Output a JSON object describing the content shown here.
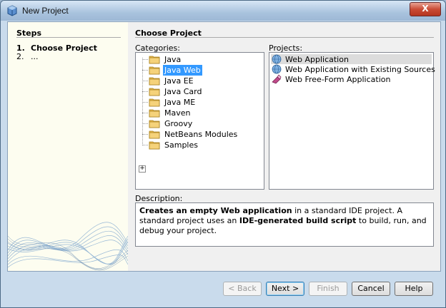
{
  "window": {
    "title": "New Project",
    "close_label": "X"
  },
  "steps": {
    "title": "Steps",
    "items": [
      {
        "num": "1.",
        "label": "Choose Project"
      },
      {
        "num": "2.",
        "label": "..."
      }
    ]
  },
  "main": {
    "title": "Choose Project",
    "categories_label": "Categories:",
    "projects_label": "Projects:",
    "description_label": "Description:",
    "categories": [
      {
        "label": "Java",
        "selected": false
      },
      {
        "label": "Java Web",
        "selected": true
      },
      {
        "label": "Java EE",
        "selected": false
      },
      {
        "label": "Java Card",
        "selected": false
      },
      {
        "label": "Java ME",
        "selected": false
      },
      {
        "label": "Maven",
        "selected": false
      },
      {
        "label": "Groovy",
        "selected": false
      },
      {
        "label": "NetBeans Modules",
        "selected": false
      },
      {
        "label": "Samples",
        "selected": false,
        "expandable": true
      }
    ],
    "projects": [
      {
        "label": "Web Application",
        "icon": "globe-icon",
        "selected": true
      },
      {
        "label": "Web Application with Existing Sources",
        "icon": "globe-icon",
        "selected": false
      },
      {
        "label": "Web Free-Form Application",
        "icon": "freeform-icon",
        "selected": false
      }
    ],
    "description": {
      "bold1": "Creates an empty Web application",
      "text1": " in a standard IDE project. A standard project uses an ",
      "bold2": "IDE-generated build script",
      "text2": " to build, run, and debug your project."
    }
  },
  "buttons": {
    "back": "< Back",
    "next": "Next >",
    "finish": "Finish",
    "cancel": "Cancel",
    "help": "Help"
  },
  "colors": {
    "selection": "#3399ff",
    "folder": "#e8b84a"
  }
}
